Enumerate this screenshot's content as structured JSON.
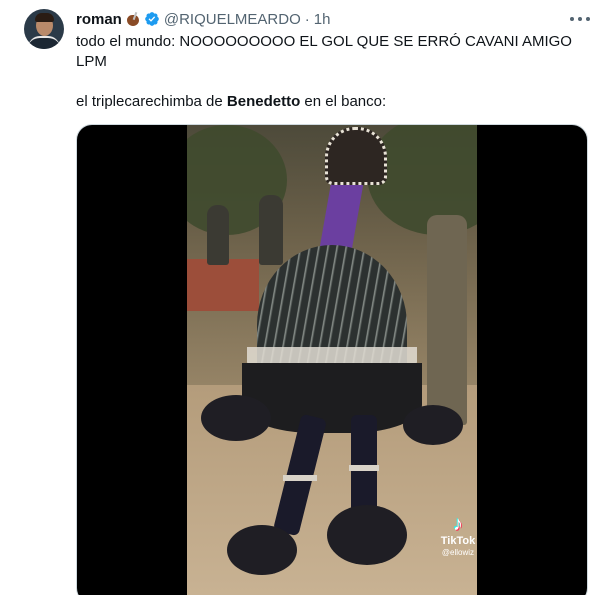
{
  "tweet": {
    "display_name": "roman",
    "handle": "@RIQUELMEARDO",
    "separator": "·",
    "time": "1h",
    "text_line1": "todo el mundo: NOOOOOOOOO EL GOL QUE SE ERRÓ CAVANI AMIGO LPM",
    "text_line2_before": "el triplecarechimba de ",
    "text_line2_bold": "Benedetto",
    "text_line2_after": " en el banco:"
  },
  "media": {
    "watermark_label": "TikTok",
    "watermark_user": "@ellowiz"
  },
  "colors": {
    "verified_blue": "#1d9bf0",
    "secondary_text": "#536471",
    "primary_text": "#0f1419"
  },
  "icons": [
    "mate-icon",
    "verified-icon",
    "more-icon",
    "tiktok-icon"
  ]
}
